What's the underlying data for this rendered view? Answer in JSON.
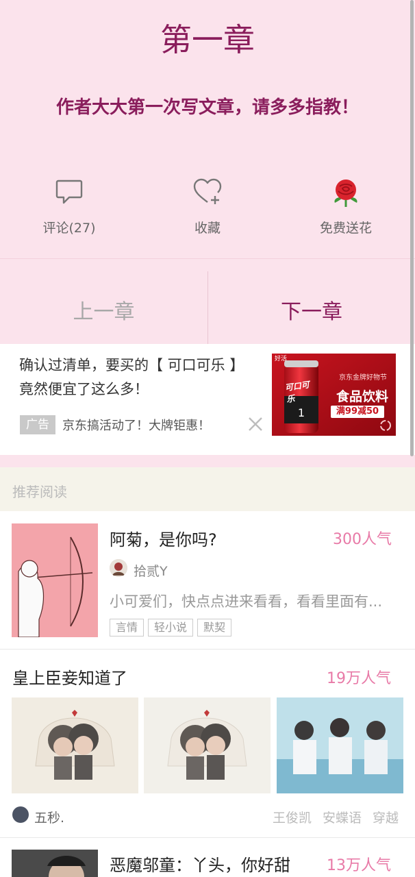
{
  "chapter": {
    "title": "第一章",
    "author_note": "作者大大第一次写文章，请多多指教！"
  },
  "actions": {
    "comment_label": "评论(27)",
    "favorite_label": "收藏",
    "flower_label": "免费送花"
  },
  "nav": {
    "prev_label": "上一章",
    "next_label": "下一章"
  },
  "ad": {
    "headline_line1": "确认过清单，要买的【 可口可乐 】",
    "headline_line2": "竟然便宜了这么多！",
    "badge": "广告",
    "source": "京东搞活动了！大牌钜惠！",
    "image_text_top": "京东金牌好物节",
    "image_text_main": "食品饮料",
    "image_text_promo": "满99减50",
    "image_text_badge": "好活",
    "image_can_text": "可口可乐"
  },
  "recommend": {
    "header": "推荐阅读",
    "books": [
      {
        "title": "阿菊，是你吗?",
        "popularity": "300人气",
        "author": "拾贰Y",
        "description": "小可爱们，快点点进来看看，看看里面有...",
        "tags": [
          "言情",
          "轻小说",
          "默契"
        ]
      },
      {
        "title": "皇上臣妾知道了",
        "popularity": "19万人气",
        "author": "五秒.",
        "tags": [
          "王俊凯",
          "安蝶语",
          "穿越"
        ]
      },
      {
        "title": "恶魔邬童：丫头，你好甜",
        "popularity": "13万人气"
      }
    ]
  },
  "colors": {
    "chapter_bg": "#fbe3ec",
    "accent": "#8a1d5c",
    "popularity": "#e87aa7"
  }
}
